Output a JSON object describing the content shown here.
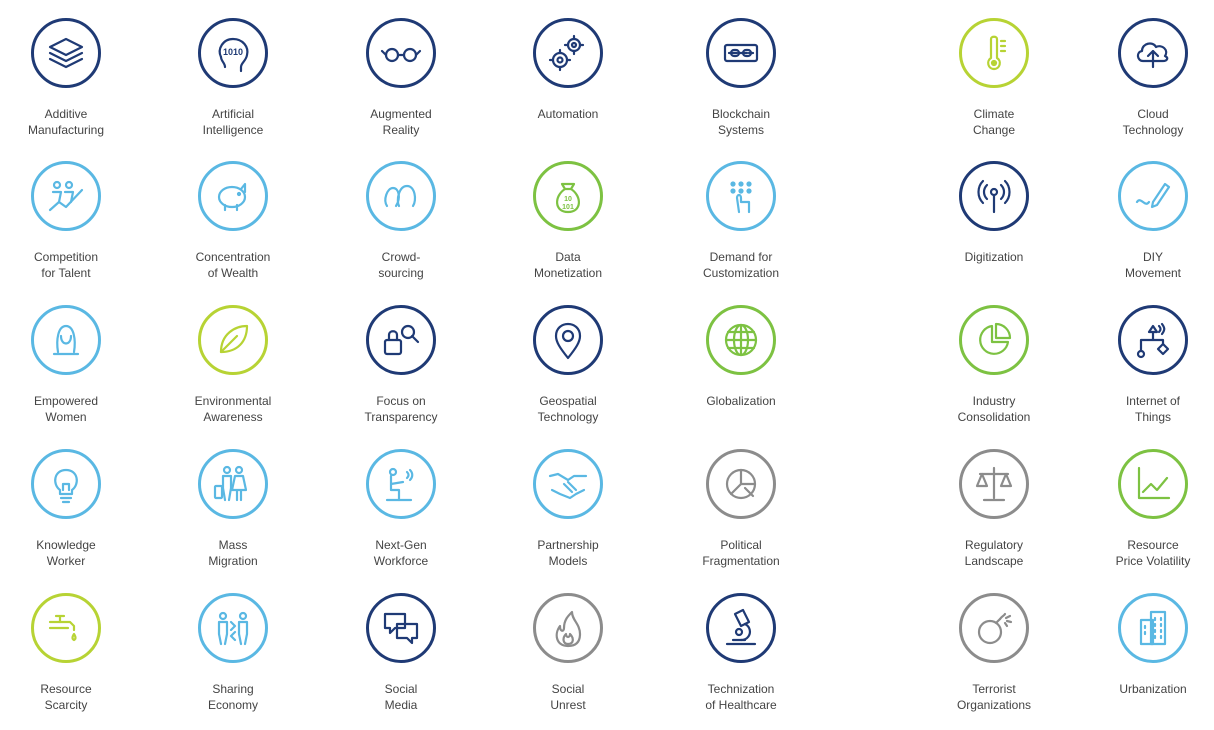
{
  "colors": {
    "navy": "#1f3a75",
    "light_blue": "#5ab8e3",
    "green": "#7dc242",
    "lime": "#b7d334",
    "gray": "#8c8c8c",
    "text": "#444444"
  },
  "items": [
    {
      "label": "Additive\nManufacturing",
      "icon": "layers-icon",
      "color": "#1f3a75"
    },
    {
      "label": "Artificial\nIntelligence",
      "icon": "brain-binary-icon",
      "color": "#1f3a75"
    },
    {
      "label": "Augmented\nReality",
      "icon": "glasses-icon",
      "color": "#1f3a75"
    },
    {
      "label": "Automation",
      "icon": "gears-icon",
      "color": "#1f3a75"
    },
    {
      "label": "Blockchain\nSystems",
      "icon": "chain-icon",
      "color": "#1f3a75"
    },
    {
      "label": "Climate\nChange",
      "icon": "thermometer-icon",
      "color": "#b7d334"
    },
    {
      "label": "Cloud\nTechnology",
      "icon": "cloud-upload-icon",
      "color": "#1f3a75"
    },
    {
      "label": "Competition\nfor Talent",
      "icon": "people-chart-icon",
      "color": "#5ab8e3"
    },
    {
      "label": "Concentration\nof Wealth",
      "icon": "piggy-bank-icon",
      "color": "#5ab8e3"
    },
    {
      "label": "Crowd-\nsourcing",
      "icon": "crowd-icon",
      "color": "#5ab8e3"
    },
    {
      "label": "Data\nMonetization",
      "icon": "money-bag-icon",
      "color": "#7dc242"
    },
    {
      "label": "Demand for\nCustomization",
      "icon": "touch-keypad-icon",
      "color": "#5ab8e3"
    },
    {
      "label": "Digitization",
      "icon": "signal-icon",
      "color": "#1f3a75"
    },
    {
      "label": "DIY\nMovement",
      "icon": "pencil-icon",
      "color": "#5ab8e3"
    },
    {
      "label": "Empowered\nWomen",
      "icon": "woman-icon",
      "color": "#5ab8e3"
    },
    {
      "label": "Environmental\nAwareness",
      "icon": "leaf-icon",
      "color": "#b7d334"
    },
    {
      "label": "Focus on\nTransparency",
      "icon": "lock-search-icon",
      "color": "#1f3a75"
    },
    {
      "label": "Geospatial\nTechnology",
      "icon": "map-pin-icon",
      "color": "#1f3a75"
    },
    {
      "label": "Globalization",
      "icon": "globe-icon",
      "color": "#7dc242"
    },
    {
      "label": "Industry\nConsolidation",
      "icon": "pie-chart-icon",
      "color": "#7dc242"
    },
    {
      "label": "Internet of\nThings",
      "icon": "iot-network-icon",
      "color": "#1f3a75"
    },
    {
      "label": "Knowledge\nWorker",
      "icon": "lightbulb-icon",
      "color": "#5ab8e3"
    },
    {
      "label": "Mass\nMigration",
      "icon": "migrants-icon",
      "color": "#5ab8e3"
    },
    {
      "label": "Next-Gen\nWorkforce",
      "icon": "worker-laptop-icon",
      "color": "#5ab8e3"
    },
    {
      "label": "Partnership\nModels",
      "icon": "handshake-icon",
      "color": "#5ab8e3"
    },
    {
      "label": "Political\nFragmentation",
      "icon": "fragmented-pie-icon",
      "color": "#8c8c8c"
    },
    {
      "label": "Regulatory\nLandscape",
      "icon": "scales-icon",
      "color": "#8c8c8c"
    },
    {
      "label": "Resource\nPrice Volatility",
      "icon": "line-chart-icon",
      "color": "#7dc242"
    },
    {
      "label": "Resource\nScarcity",
      "icon": "faucet-icon",
      "color": "#b7d334"
    },
    {
      "label": "Sharing\nEconomy",
      "icon": "people-exchange-icon",
      "color": "#5ab8e3"
    },
    {
      "label": "Social\nMedia",
      "icon": "chat-bubbles-icon",
      "color": "#1f3a75"
    },
    {
      "label": "Social\nUnrest",
      "icon": "fire-icon",
      "color": "#8c8c8c"
    },
    {
      "label": "Technization\nof Healthcare",
      "icon": "microscope-icon",
      "color": "#1f3a75"
    },
    {
      "label": "Terrorist\nOrganizations",
      "icon": "bomb-icon",
      "color": "#8c8c8c"
    },
    {
      "label": "Urbanization",
      "icon": "buildings-icon",
      "color": "#5ab8e3"
    }
  ]
}
